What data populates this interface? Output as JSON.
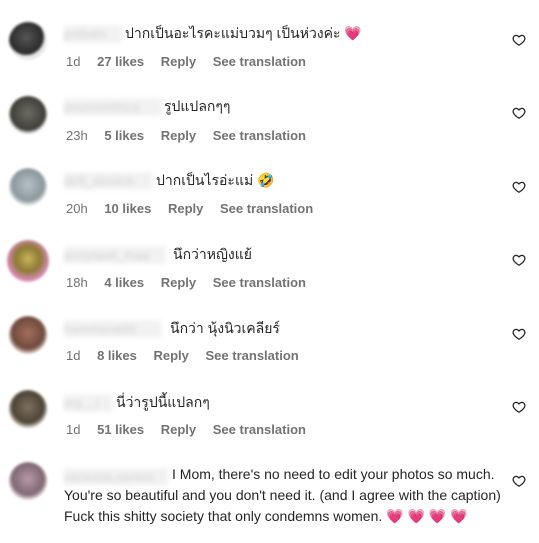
{
  "comments": [
    {
      "username": "pnibalo",
      "text": "ปากเป็นอะไรคะแม่บวมๆ เป็นห่วงค่ะ",
      "emoji": "💗",
      "time": "1d",
      "likes": "27 likes",
      "reply": "Reply",
      "translate": "See translation",
      "avatar_color": "#3b3b3b"
    },
    {
      "username": "pourromthica",
      "text": "รูปแปลกๆๆ",
      "emoji": "",
      "time": "23h",
      "likes": "5 likes",
      "reply": "Reply",
      "translate": "See translation",
      "avatar_color": "#5a5a52"
    },
    {
      "username": "deft_devitch",
      "text": "ปากเป็นไรอ่ะแม่",
      "emoji": "🤣",
      "time": "20h",
      "likes": "10 likes",
      "reply": "Reply",
      "translate": "See translation",
      "avatar_color": "#9aa6ab"
    },
    {
      "username": "punyapat_mqq",
      "text": "นึกว่าหญิงแย้",
      "emoji": "",
      "time": "18h",
      "likes": "4 likes",
      "reply": "Reply",
      "translate": "See translation",
      "avatar_color": "#b8a24a"
    },
    {
      "username": "nammonatttt",
      "text": "นึกว่า นุ้งนิวเคลียร์",
      "emoji": "",
      "time": "1d",
      "likes": "8 likes",
      "reply": "Reply",
      "translate": "See translation",
      "avatar_color": "#8a5a4a"
    },
    {
      "username": "jnq__i",
      "text": "นี่ว่ารูปนี้แปลกๆ",
      "emoji": "",
      "time": "1d",
      "likes": "51 likes",
      "reply": "Reply",
      "translate": "See translation",
      "avatar_color": "#6b5f4a"
    },
    {
      "username": "vanessa.santos",
      "text": "I Mom, there's no need to edit your photos so much. You're so beautiful and you don't need it. (and I agree with the caption) Fuck this shitty society that only condemns women.",
      "emoji": "💗 💗 💗 💗",
      "time": "",
      "likes": "",
      "reply": "",
      "translate": "",
      "avatar_color": "#a98f9a"
    }
  ]
}
